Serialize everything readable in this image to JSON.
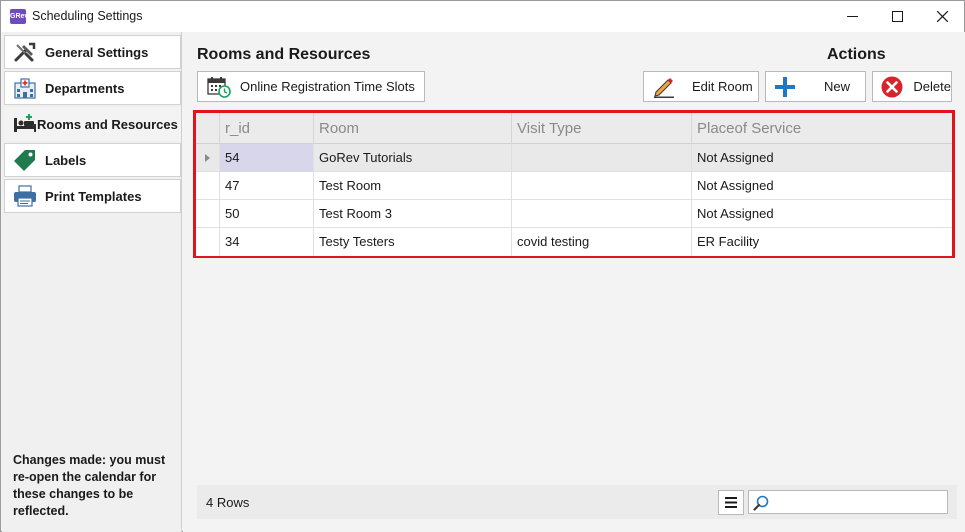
{
  "window": {
    "title": "Scheduling Settings",
    "app_icon_text": "GRev"
  },
  "nav": {
    "items": [
      {
        "label": "General Settings",
        "icon": "tools-icon"
      },
      {
        "label": "Departments",
        "icon": "building-icon"
      },
      {
        "label": "Rooms and Resources",
        "icon": "bed-icon"
      },
      {
        "label": "Labels",
        "icon": "tag-icon"
      },
      {
        "label": "Print Templates",
        "icon": "printer-icon"
      }
    ],
    "selected_index": 2,
    "note": "Changes made: you must re-open the calendar for these changes to be reflected."
  },
  "main": {
    "section_title": "Rooms and Resources",
    "actions_title": "Actions",
    "buttons": {
      "slots": "Online Registration Time Slots",
      "edit": "Edit Room",
      "new": "New",
      "delete": "Delete"
    },
    "grid": {
      "columns": [
        "r_id",
        "Room",
        "Visit Type",
        "Placeof Service"
      ],
      "rows": [
        {
          "r_id": "54",
          "room": "GoRev Tutorials",
          "visit_type": "",
          "place": "Not Assigned"
        },
        {
          "r_id": "47",
          "room": "Test Room",
          "visit_type": "",
          "place": "Not Assigned"
        },
        {
          "r_id": "50",
          "room": "Test Room 3",
          "visit_type": "",
          "place": "Not Assigned"
        },
        {
          "r_id": "34",
          "room": "Testy Testers",
          "visit_type": "covid testing",
          "place": "ER Facility"
        }
      ],
      "selected_row": 0
    },
    "footer": {
      "row_count": "4 Rows",
      "search_placeholder": "",
      "search_value": ""
    }
  },
  "colors": {
    "highlight_border": "#e0141e",
    "accent_blue": "#1e78c8",
    "delete_red": "#d9232b",
    "selected_cell": "#d7d6ea"
  }
}
